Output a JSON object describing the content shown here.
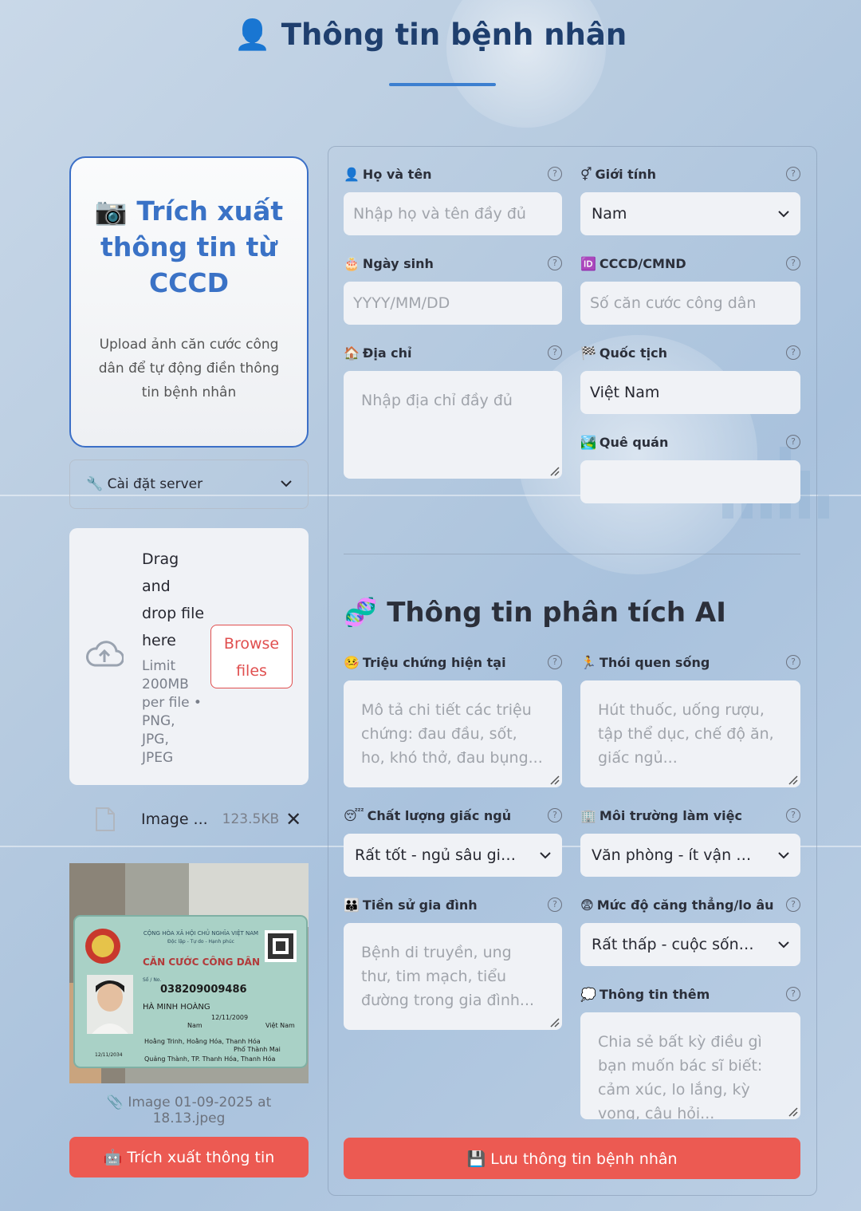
{
  "page": {
    "title_icon": "👤",
    "title": "Thông tin bệnh nhân"
  },
  "cccd_card": {
    "icon": "📷",
    "title": "Trích xuất thông tin từ CCCD",
    "subtitle": "Upload ảnh căn cước công dân để tự động điền thông tin bệnh nhân"
  },
  "server_settings": {
    "label": "🔧 Cài đặt server"
  },
  "uploader": {
    "drag_text": "Drag and drop file here",
    "limit_text": "Limit 200MB per file • PNG, JPG, JPEG",
    "browse_label": "Browse files"
  },
  "uploaded_file": {
    "name": "Image ...",
    "size": "123.5KB",
    "caption": "Image 01-09-2025 at 18.13.jpeg"
  },
  "id_card": {
    "header_1": "CỘNG HÒA XÃ HỘI CHỦ NGHĨA VIỆT NAM",
    "header_2": "Độc lập - Tự do - Hạnh phúc",
    "card_type": "CĂN CƯỚC CÔNG DÂN",
    "number_label": "Số / No.",
    "number": "038209009486",
    "name": "HÀ MINH HOÀNG",
    "dob": "12/11/2009",
    "sex": "Nam",
    "nationality": "Việt Nam",
    "origin": "Hoằng Trinh, Hoằng Hóa, Thanh Hóa",
    "residence_1": "Phố Thành Mai",
    "residence_2": "Quảng Thành, TP. Thanh Hóa, Thanh Hóa",
    "expiry": "12/11/2034"
  },
  "extract_button": {
    "label": "🤖 Trích xuất thông tin"
  },
  "form": {
    "fullname": {
      "icon": "👤",
      "label": "Họ và tên",
      "placeholder": "Nhập họ và tên đầy đủ"
    },
    "gender": {
      "icon": "⚥",
      "label": "Giới tính",
      "value": "Nam"
    },
    "dob": {
      "icon": "🎂",
      "label": "Ngày sinh",
      "placeholder": "YYYY/MM/DD"
    },
    "id_number": {
      "icon": "🆔",
      "label": "CCCD/CMND",
      "placeholder": "Số căn cước công dân"
    },
    "address": {
      "icon": "🏠",
      "label": "Địa chỉ",
      "placeholder": "Nhập địa chỉ đầy đủ"
    },
    "nationality": {
      "icon": "🏁",
      "label": "Quốc tịch",
      "value": "Việt Nam"
    },
    "hometown": {
      "icon": "🏞️",
      "label": "Quê quán",
      "value": ""
    }
  },
  "ai_section": {
    "icon": "🧬",
    "title": "Thông tin phân tích AI",
    "symptoms": {
      "icon": "🤒",
      "label": "Triệu chứng hiện tại",
      "placeholder": "Mô tả chi tiết các triệu chứng: đau đầu, sốt, ho, khó thở, đau bụng..."
    },
    "lifestyle": {
      "icon": "🏃",
      "label": "Thói quen sống",
      "placeholder": "Hút thuốc, uống rượu, tập thể dục, chế độ ăn, giấc ngủ..."
    },
    "sleep": {
      "icon": "😴",
      "label": "Chất lượng giấc ngủ",
      "value": "Rất tốt - ngủ sâu giấc, thức dậy tỉnh táo"
    },
    "work_env": {
      "icon": "🏢",
      "label": "Môi trường làm việc",
      "value": "Văn phòng - ít vận động"
    },
    "family_history": {
      "icon": "👪",
      "label": "Tiền sử gia đình",
      "placeholder": "Bệnh di truyền, ung thư, tim mạch, tiểu đường trong gia đình..."
    },
    "stress": {
      "icon": "😨",
      "label": "Mức độ căng thẳng/lo âu",
      "value": "Rất thấp - cuộc sống thoải mái"
    },
    "additional": {
      "icon": "💭",
      "label": "Thông tin thêm",
      "placeholder": "Chia sẻ bất kỳ điều gì bạn muốn bác sĩ biết: cảm xúc, lo lắng, kỳ vọng, câu hỏi..."
    }
  },
  "save_button": {
    "label": "💾 Lưu thông tin bệnh nhân"
  },
  "colors": {
    "accent": "#3a72c6",
    "primary_button": "#ec5a52",
    "title": "#1f3f6e"
  }
}
